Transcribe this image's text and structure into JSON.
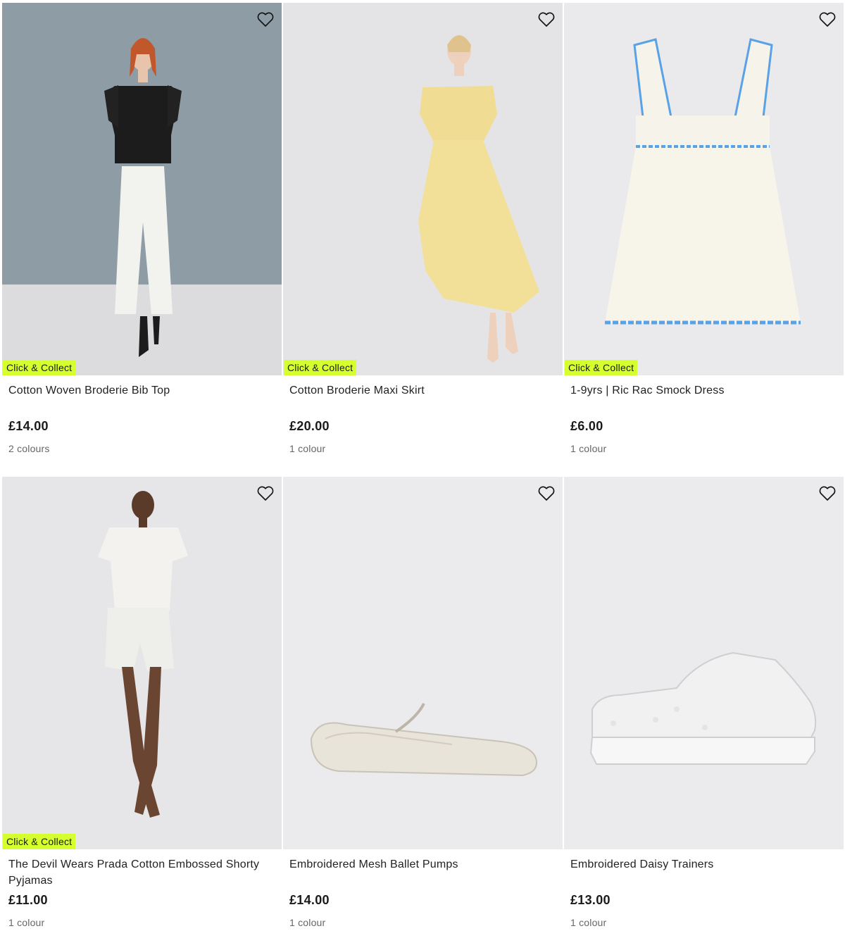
{
  "products": [
    {
      "title": "Cotton Woven Broderie Bib Top",
      "price": "£14.00",
      "colours": "2 colours",
      "badge": "Click & Collect",
      "image": "model-black-ruffle-top-white-trousers"
    },
    {
      "title": "Cotton Broderie Maxi Skirt",
      "price": "£20.00",
      "colours": "1 colour",
      "badge": "Click & Collect",
      "image": "model-yellow-broderie-set"
    },
    {
      "title": "1-9yrs | Ric Rac Smock Dress",
      "price": "£6.00",
      "colours": "1 colour",
      "badge": "Click & Collect",
      "image": "white-smock-dress-blue-ricrac"
    },
    {
      "title": "The Devil Wears Prada Cotton Embossed Shorty Pyjamas",
      "price": "£11.00",
      "colours": "1 colour",
      "badge": "Click & Collect",
      "image": "model-white-shorty-pyjamas"
    },
    {
      "title": "Embroidered Mesh Ballet Pumps",
      "price": "£14.00",
      "colours": "1 colour",
      "badge": "",
      "image": "white-mesh-ballet-pump"
    },
    {
      "title": "Embroidered Daisy Trainers",
      "price": "£13.00",
      "colours": "1 colour",
      "badge": "",
      "image": "white-daisy-trainer"
    }
  ],
  "icons": {
    "favourite": "heart-outline-icon"
  },
  "colors": {
    "badge": "#d6ff2e"
  }
}
